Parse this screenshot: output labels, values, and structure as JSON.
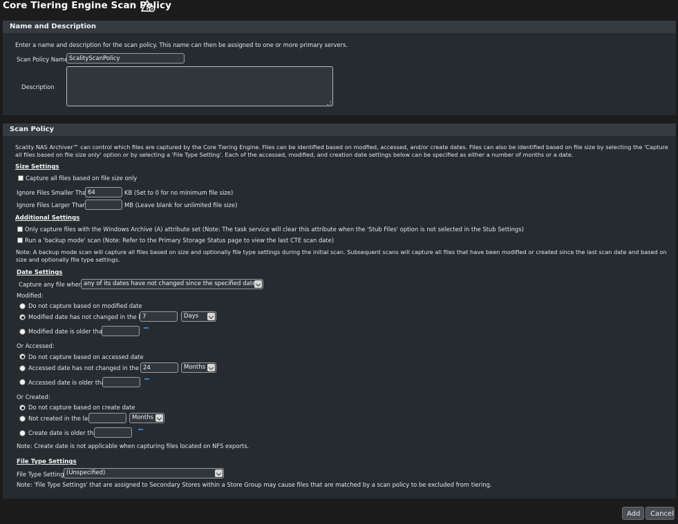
{
  "page": {
    "title": "Core Tiering Engine Scan Policy",
    "title_icon": "warning-gear-icon"
  },
  "name_section": {
    "header": "Name and Description",
    "intro": "Enter a name and description for the scan policy. This name can then be assigned to one or more primary servers.",
    "name_label": "Scan Policy Name",
    "name_value": "ScalityScanPolicy",
    "description_label": "Description",
    "description_value": ""
  },
  "scan_section": {
    "header": "Scan Policy",
    "intro": "Scality NAS Archiver™ can control which files are captured by the Core Tiering Engine. Files can be identified based on modfied, accessed, and/or create dates.  Files can also be identified based on file size by selecting the 'Capture all files based on file size only' option or by selecting a 'File Type Setting'.  Each of the accessed, modified, and creation date settings below can be specified as either a number of months or a date."
  },
  "size_settings": {
    "title": "Size Settings",
    "capture_by_size_label": "Capture all files based on file size only",
    "smaller_label": "Ignore Files Smaller Than",
    "smaller_value": "64",
    "smaller_note": "KB  (Set to 0 for no minimum file size)",
    "larger_label": "Ignore Files Larger Than",
    "larger_value": "",
    "larger_note": "MB (Leave blank for unlimited file size)"
  },
  "additional_settings": {
    "title": "Additional Settings",
    "archive_attr_label": "Only capture files with the Windows Archive (A) attribute set (Note: The task service will clear this attribute when the 'Stub Files' option is not selected in the Stub Settings)",
    "backup_mode_label": "Run a 'backup mode' scan (Note: Refer to the Primary Storage Status page to view the last CTE scan date)",
    "note": "Note: A backup mode scan will capture all files based on size and optionally file type settings during the initial scan. Subsequent scans will capture all files that have been modified or created since the last scan date and based on size and optionally file type settings."
  },
  "date_settings": {
    "title": "Date Settings",
    "capture_label": "Capture any file where:",
    "capture_value": "any of its dates have not changed since the specified dates",
    "modified": {
      "label": "Modified:",
      "opt_none": "Do not capture based on modified date",
      "opt_last": "Modified date has not changed in the last",
      "last_value": "7",
      "unit": "Days",
      "opt_older": "Modified date is older than",
      "older_value": ""
    },
    "accessed": {
      "label": "Or Accessed:",
      "opt_none": "Do not capture based on accessed date",
      "opt_last": "Accessed date has not changed in the last",
      "last_value": "24",
      "unit": "Months",
      "opt_older": "Accessed date is older than",
      "older_value": ""
    },
    "created": {
      "label": "Or Created:",
      "opt_none": "Do not capture based on create date",
      "opt_last": "Not created in the last",
      "last_value": "",
      "unit": "Months",
      "opt_older": "Create date is older than",
      "older_value": "",
      "note": "Note: Create date is not applicable when capturing files located on NFS exports."
    }
  },
  "file_type_settings": {
    "title": "File Type Settings",
    "label": "File Type Settings",
    "value": "(Unspecified)",
    "note": "Note: 'File Type Settings' that are assigned to Secondary Stores within a Store Group may cause files that are matched by a scan policy to be excluded from tiering."
  },
  "actions": {
    "add_label": "Add",
    "cancel_label": "Cancel"
  }
}
